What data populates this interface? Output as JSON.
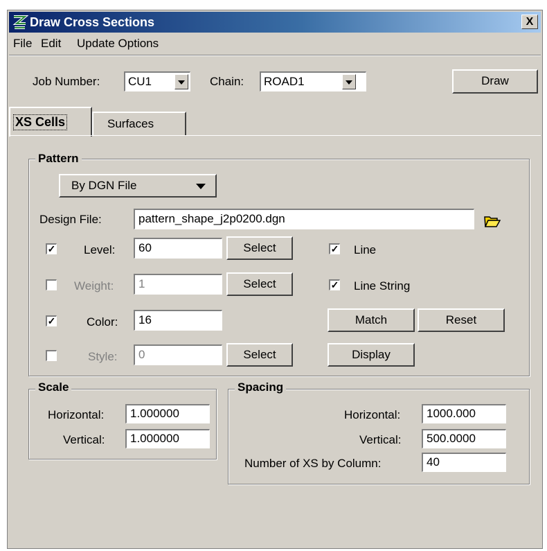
{
  "window": {
    "title": "Draw Cross Sections",
    "close_label": "X"
  },
  "menu": [
    "File",
    "Edit",
    "Update Options"
  ],
  "header": {
    "job_label": "Job Number:",
    "job_value": "CU1",
    "chain_label": "Chain:",
    "chain_value": "ROAD1",
    "draw_label": "Draw"
  },
  "tabs": [
    {
      "label": "XS Cells",
      "active": true
    },
    {
      "label": "Surfaces",
      "active": false
    }
  ],
  "pattern": {
    "group_label": "Pattern",
    "mode_value": "By DGN File",
    "design_file_label": "Design File:",
    "design_file_value": "pattern_shape_j2p0200.dgn",
    "level": {
      "label": "Level:",
      "value": "60",
      "checked": true
    },
    "weight": {
      "label": "Weight:",
      "value": "1",
      "checked": false
    },
    "color": {
      "label": "Color:",
      "value": "16",
      "checked": true
    },
    "style": {
      "label": "Style:",
      "value": "0",
      "checked": false
    },
    "select_label": "Select",
    "line_label": "Line",
    "line_checked": true,
    "line_string_label": "Line String",
    "line_string_checked": true,
    "match_label": "Match",
    "reset_label": "Reset",
    "display_label": "Display"
  },
  "scale": {
    "group_label": "Scale",
    "horizontal_label": "Horizontal:",
    "horizontal_value": "1.000000",
    "vertical_label": "Vertical:",
    "vertical_value": "1.000000"
  },
  "spacing": {
    "group_label": "Spacing",
    "horizontal_label": "Horizontal:",
    "horizontal_value": "1000.000",
    "vertical_label": "Vertical:",
    "vertical_value": "500.0000",
    "count_label": "Number of XS by Column:",
    "count_value": "40"
  },
  "colors": {
    "titlebar_start": "#0a246a",
    "titlebar_end": "#a6caf0",
    "face": "#d4d0c8"
  }
}
